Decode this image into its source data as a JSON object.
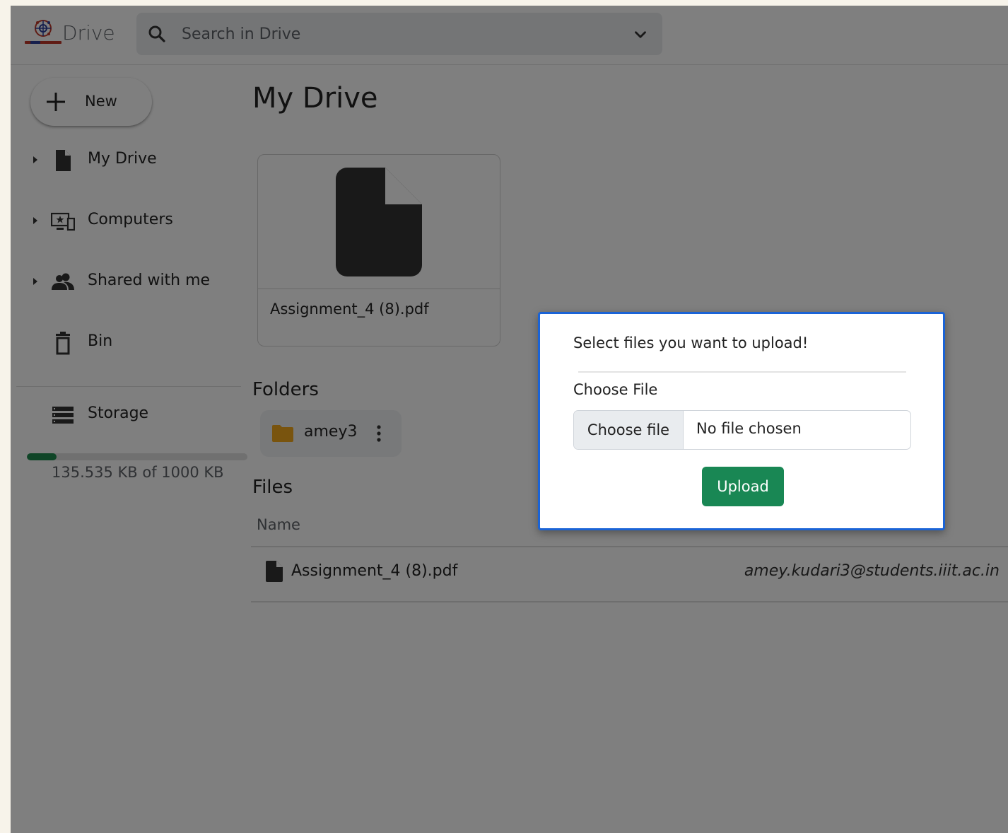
{
  "header": {
    "brand": "Drive",
    "search_placeholder": "Search in Drive"
  },
  "sidebar": {
    "new_label": "New",
    "items": [
      {
        "label": "My Drive",
        "icon": "file-icon",
        "expandable": true
      },
      {
        "label": "Computers",
        "icon": "computer-icon",
        "expandable": true
      },
      {
        "label": "Shared with me",
        "icon": "people-icon",
        "expandable": true
      },
      {
        "label": "Bin",
        "icon": "trash-icon",
        "expandable": false
      },
      {
        "label": "Storage",
        "icon": "storage-icon",
        "expandable": false
      }
    ],
    "storage": {
      "text": "135.535 KB of 1000 KB",
      "used_fraction": 0.1355
    }
  },
  "main": {
    "title": "My Drive",
    "suggested_file": {
      "name": "Assignment_4 (8).pdf"
    },
    "folders_title": "Folders",
    "folders": [
      {
        "name": "amey3"
      }
    ],
    "files_title": "Files",
    "columns": {
      "name": "Name"
    },
    "files": [
      {
        "name": "Assignment_4 (8).pdf",
        "owner": "amey.kudari3@students.iiit.ac.in"
      }
    ]
  },
  "modal": {
    "title": "Select files you want to upload!",
    "field_label": "Choose File",
    "choose_button": "Choose file",
    "file_status": "No file chosen",
    "upload_button": "Upload"
  },
  "colors": {
    "accent_green": "#198754",
    "modal_border": "#1a63d6",
    "folder": "#f2a81d"
  }
}
